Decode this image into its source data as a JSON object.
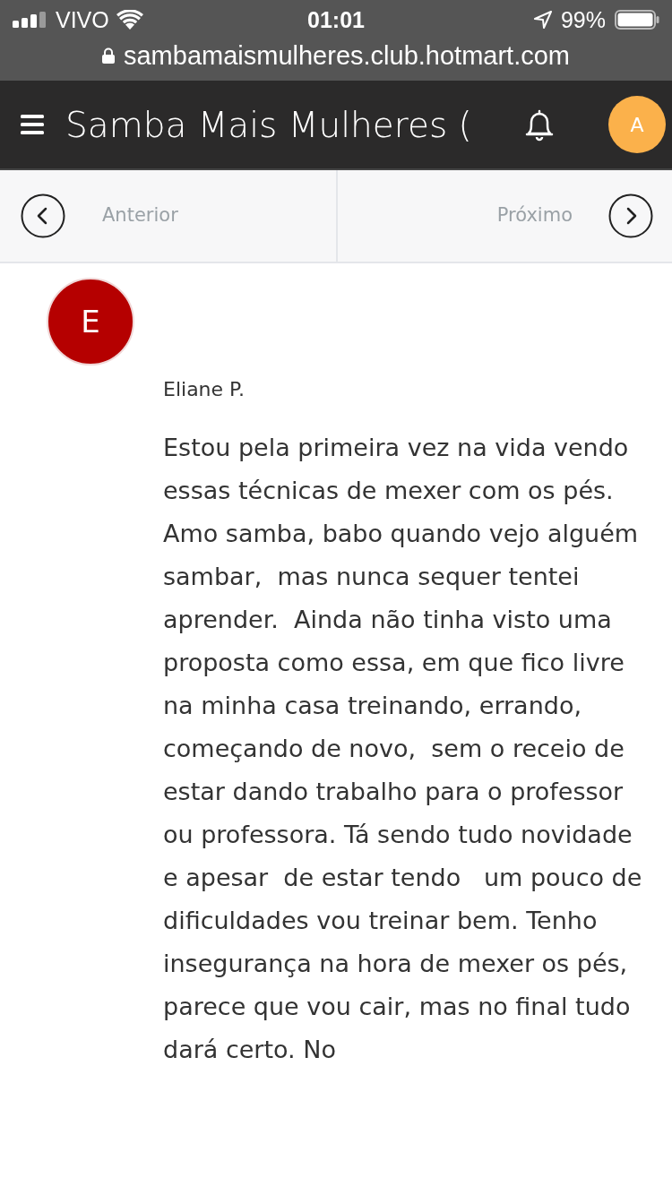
{
  "status_bar": {
    "carrier": "VIVO",
    "time": "01:01",
    "battery": "99%"
  },
  "address_bar": {
    "url": "sambamaismulheres.club.hotmart.com"
  },
  "header": {
    "title": "Samba Mais Mulheres (",
    "avatar_initial": "A"
  },
  "lesson_nav": {
    "previous": "Anterior",
    "next": "Próximo"
  },
  "comment": {
    "avatar_initial": "E",
    "author": "Eliane P.",
    "text": "Estou pela primeira vez na vida vendo essas técnicas de mexer com os pés. Amo samba, babo quando vejo alguém sambar,  mas nunca sequer tentei aprender.  Ainda não tinha visto uma proposta como essa, em que fico livre na minha casa treinando, errando, começando de novo,  sem o receio de estar dando trabalho para o professor ou professora. Tá sendo tudo novidade e apesar  de estar tendo   um pouco de dificuldades vou treinar bem. Tenho insegurança na hora de mexer os pés, parece que vou cair, mas no final tudo dará certo. No"
  }
}
